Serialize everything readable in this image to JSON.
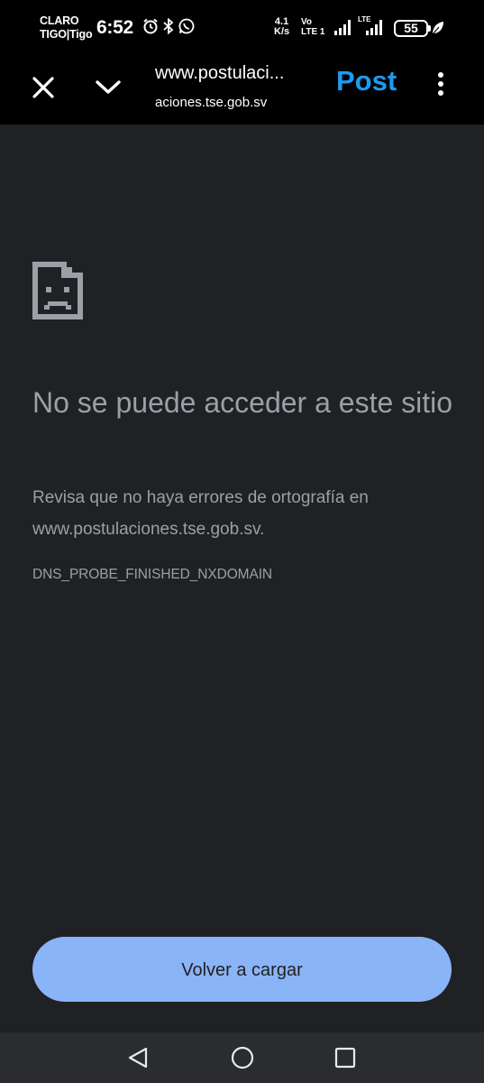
{
  "status_bar": {
    "carrier_line1": "CLARO",
    "carrier_line2": "TIGO|Tigo",
    "time": "6:52",
    "net_speed_value": "4.1",
    "net_speed_unit": "K/s",
    "volte_line1": "Vo",
    "volte_line2": "LTE 1",
    "lte_label": "LTE",
    "battery_level": "55",
    "icons": [
      "alarm-icon",
      "bluetooth-icon",
      "whatsapp-icon",
      "signal-icon",
      "signal-icon",
      "battery-icon",
      "leaf-icon"
    ]
  },
  "toolbar": {
    "title": "www.postulaci...",
    "subtitle": "aciones.tse.gob.sv",
    "post_label": "Post",
    "icons": [
      "close-icon",
      "chevron-down-icon",
      "more-vert-icon"
    ]
  },
  "error_page": {
    "title": "No se puede acceder a este sitio",
    "description": "Revisa que no haya errores de ortografía en www.postulaciones.tse.gob.sv.",
    "error_code": "DNS_PROBE_FINISHED_NXDOMAIN",
    "reload_label": "Volver a cargar",
    "icon": "sad-document-icon"
  },
  "colors": {
    "page_background": "#202124",
    "text_secondary": "#9aa0a6",
    "button_background": "#8ab4f8",
    "post_accent": "#1d9bf0",
    "toolbar_background": "#000000"
  },
  "nav_bar": {
    "icons": [
      "back-triangle-icon",
      "home-circle-icon",
      "recents-square-icon"
    ]
  }
}
